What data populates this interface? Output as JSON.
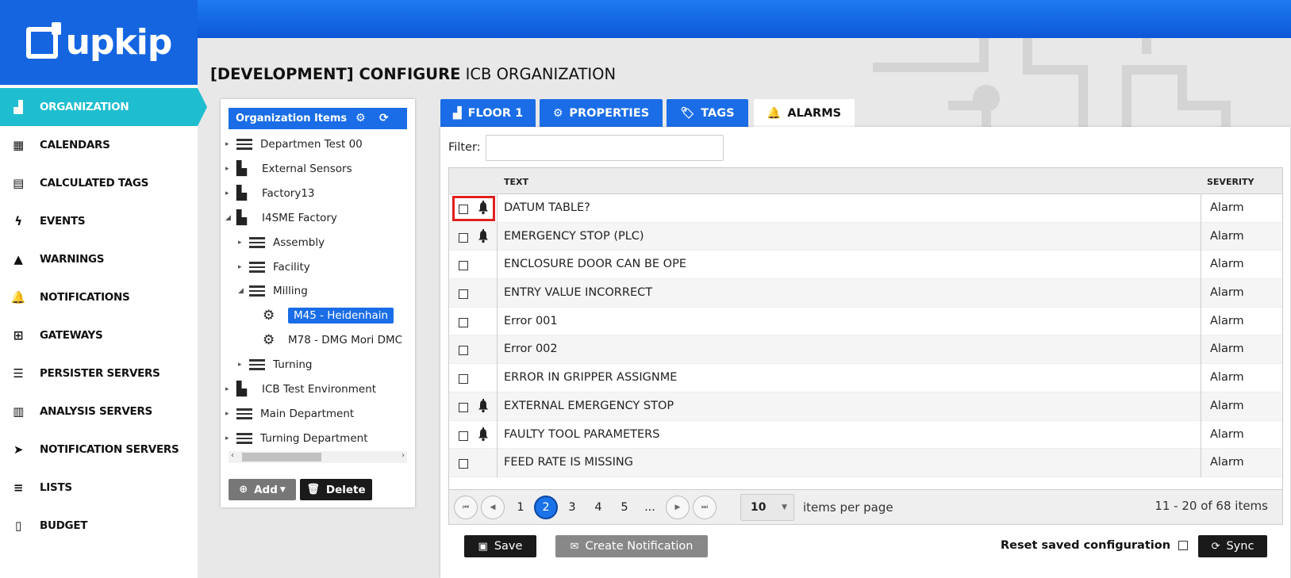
{
  "brand": {
    "logo_text": "upkip",
    "accent": "#1565e0",
    "active_nav_color": "#1fbdd0"
  },
  "sidebar": {
    "collapse_glyph": "«",
    "items": [
      {
        "label": "ORGANIZATION",
        "icon": "factory-icon"
      },
      {
        "label": "CALENDARS",
        "icon": "calendar-icon"
      },
      {
        "label": "CALCULATED TAGS",
        "icon": "calculator-icon"
      },
      {
        "label": "EVENTS",
        "icon": "bolt-icon"
      },
      {
        "label": "WARNINGS",
        "icon": "warning-icon"
      },
      {
        "label": "NOTIFICATIONS",
        "icon": "bell-icon"
      },
      {
        "label": "GATEWAYS",
        "icon": "sitemap-icon"
      },
      {
        "label": "PERSISTER SERVERS",
        "icon": "server-icon"
      },
      {
        "label": "ANALYSIS SERVERS",
        "icon": "chart-icon"
      },
      {
        "label": "NOTIFICATION SERVERS",
        "icon": "paper-plane-icon"
      },
      {
        "label": "LISTS",
        "icon": "list-icon"
      },
      {
        "label": "BUDGET",
        "icon": "invoice-icon"
      }
    ]
  },
  "page": {
    "title_bold": "[DEVELOPMENT] CONFIGURE",
    "title_rest": "ICB ORGANIZATION"
  },
  "org": {
    "header": "Organization Items",
    "tree": [
      {
        "label": "Departmen Test 00",
        "icon": "server",
        "arrow": "▸"
      },
      {
        "label": "External Sensors",
        "icon": "building",
        "arrow": "▸"
      },
      {
        "label": "Factory13",
        "icon": "building",
        "arrow": "▸"
      },
      {
        "label": "I4SME Factory",
        "icon": "building",
        "arrow": "◢"
      },
      {
        "label": "Assembly",
        "icon": "server",
        "arrow": "▸"
      },
      {
        "label": "Facility",
        "icon": "server",
        "arrow": "▸"
      },
      {
        "label": "Milling",
        "icon": "server",
        "arrow": "◢"
      },
      {
        "label": "M45 - Heidenhain",
        "icon": "gear",
        "arrow": ""
      },
      {
        "label": "M78 - DMG Mori DMC",
        "icon": "gear",
        "arrow": ""
      },
      {
        "label": "Turning",
        "icon": "server",
        "arrow": "▸"
      },
      {
        "label": "ICB Test Environment",
        "icon": "building",
        "arrow": "▸"
      },
      {
        "label": "Main Department",
        "icon": "server",
        "arrow": "▸"
      },
      {
        "label": "Turning Department",
        "icon": "server",
        "arrow": "▸"
      }
    ],
    "add_label": "Add",
    "delete_label": "Delete"
  },
  "tabs": [
    {
      "label": "FLOOR 1",
      "icon": "factory-icon"
    },
    {
      "label": "PROPERTIES",
      "icon": "gear-icon"
    },
    {
      "label": "TAGS",
      "icon": "tag-icon"
    },
    {
      "label": "ALARMS",
      "icon": "bell-icon"
    }
  ],
  "filter": {
    "label": "Filter:",
    "value": "",
    "placeholder": ""
  },
  "grid": {
    "columns": [
      "TEXT",
      "SEVERITY"
    ],
    "rows": [
      {
        "text": "DATUM TABLE?",
        "severity": "Alarm",
        "bell": true
      },
      {
        "text": "EMERGENCY STOP (PLC)",
        "severity": "Alarm",
        "bell": true
      },
      {
        "text": "ENCLOSURE DOOR CAN BE OPE",
        "severity": "Alarm",
        "bell": false
      },
      {
        "text": "ENTRY VALUE INCORRECT",
        "severity": "Alarm",
        "bell": false
      },
      {
        "text": "Error 001",
        "severity": "Alarm",
        "bell": false
      },
      {
        "text": "Error 002",
        "severity": "Alarm",
        "bell": false
      },
      {
        "text": "ERROR IN GRIPPER ASSIGNME",
        "severity": "Alarm",
        "bell": false
      },
      {
        "text": "EXTERNAL EMERGENCY STOP",
        "severity": "Alarm",
        "bell": true
      },
      {
        "text": "FAULTY TOOL PARAMETERS",
        "severity": "Alarm",
        "bell": true
      },
      {
        "text": "FEED RATE IS MISSING",
        "severity": "Alarm",
        "bell": false
      }
    ]
  },
  "pager": {
    "pages": [
      "1",
      "2",
      "3",
      "4",
      "5",
      "..."
    ],
    "current": "2",
    "per_page": "10",
    "per_page_label": "items per page",
    "range": "11 - 20 of 68 items"
  },
  "footer": {
    "save_label": "Save",
    "notification_label": "Create Notification",
    "reset_label": "Reset saved configuration",
    "sync_label": "Sync"
  }
}
